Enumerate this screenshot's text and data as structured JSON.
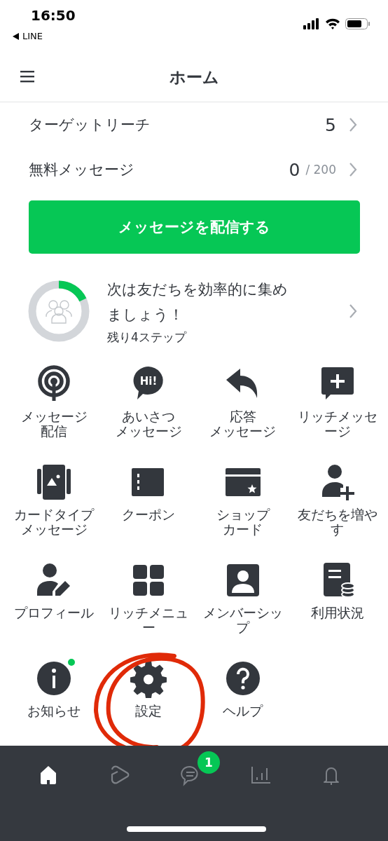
{
  "status_bar": {
    "time": "16:50",
    "back_label": "LINE"
  },
  "header": {
    "title": "ホーム"
  },
  "stats": [
    {
      "label": "ターゲットリーチ",
      "value": "5"
    },
    {
      "label": "無料メッセージ",
      "value": "0",
      "total": "/ 200"
    }
  ],
  "primary_button": {
    "label": "メッセージを配信する"
  },
  "progress": {
    "title": "次は友だちを効率的に集めましょう！",
    "subtitle": "残り4ステップ"
  },
  "features": [
    {
      "label": [
        "メッセージ",
        "配信"
      ],
      "dot": false,
      "circled": false
    },
    {
      "label": [
        "あいさつ",
        "メッセージ"
      ],
      "icon_text": "Hi!",
      "dot": false,
      "circled": false
    },
    {
      "label": [
        "応答",
        "メッセージ"
      ],
      "dot": false,
      "circled": false
    },
    {
      "label": [
        "リッチメッセ",
        "ージ"
      ],
      "dot": false,
      "circled": false
    },
    {
      "label": [
        "カードタイプ",
        "メッセージ"
      ],
      "dot": false,
      "circled": false
    },
    {
      "label": [
        "クーポン"
      ],
      "dot": false,
      "circled": false
    },
    {
      "label": [
        "ショップ",
        "カード"
      ],
      "dot": false,
      "circled": false
    },
    {
      "label": [
        "友だちを増や",
        "す"
      ],
      "dot": false,
      "circled": false
    },
    {
      "label": [
        "プロフィール"
      ],
      "dot": false,
      "circled": false
    },
    {
      "label": [
        "リッチメニュ",
        "ー"
      ],
      "dot": false,
      "circled": false
    },
    {
      "label": [
        "メンバーシッ",
        "プ"
      ],
      "dot": false,
      "circled": false
    },
    {
      "label": [
        "利用状況"
      ],
      "dot": false,
      "circled": false
    },
    {
      "label": [
        "お知らせ"
      ],
      "dot": true,
      "circled": false
    },
    {
      "label": [
        "設定"
      ],
      "dot": false,
      "circled": true
    },
    {
      "label": [
        "ヘルプ"
      ],
      "dot": false,
      "circled": false
    }
  ],
  "bottom_nav": [
    {
      "selected": true
    },
    {
      "selected": false
    },
    {
      "selected": false,
      "badge": "1"
    },
    {
      "selected": false
    },
    {
      "selected": false
    }
  ]
}
